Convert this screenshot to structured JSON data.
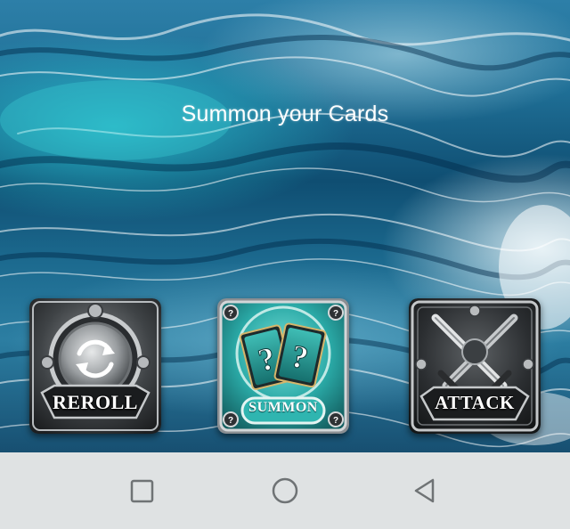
{
  "screen": {
    "title": "Summon your Cards"
  },
  "actions": {
    "reroll": {
      "label": "REROLL",
      "icon": "refresh-icon"
    },
    "summon": {
      "label": "SUMMON",
      "icon": "mystery-cards-icon"
    },
    "attack": {
      "label": "ATTACK",
      "icon": "crossed-swords-icon"
    }
  },
  "navigation_bar": {
    "buttons": [
      {
        "name": "recents",
        "icon": "square-icon"
      },
      {
        "name": "home",
        "icon": "circle-icon"
      },
      {
        "name": "back",
        "icon": "triangle-back-icon"
      }
    ]
  },
  "colors": {
    "teal_accent": "#2fb5b0",
    "metal_dark": "#2e3134",
    "navbar": "#dfe2e3"
  }
}
